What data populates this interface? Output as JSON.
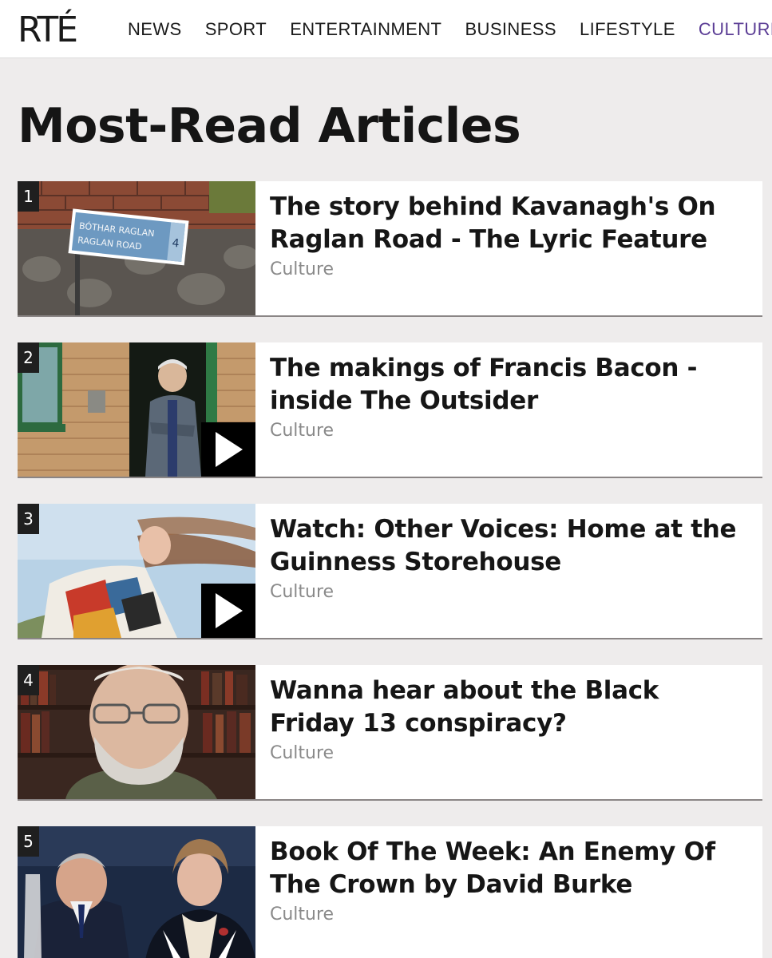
{
  "site": {
    "logo": "RTÉ"
  },
  "nav": {
    "items": [
      {
        "label": "NEWS"
      },
      {
        "label": "SPORT"
      },
      {
        "label": "ENTERTAINMENT"
      },
      {
        "label": "BUSINESS"
      },
      {
        "label": "LIFESTYLE"
      },
      {
        "label": "CULTURE"
      }
    ],
    "active": "CULTURE",
    "active_color": "#5b3d95"
  },
  "page": {
    "title": "Most-Read Articles"
  },
  "articles": [
    {
      "rank": "1",
      "title": "The story behind Kavanagh's On Raglan Road - The Lyric Feature",
      "category": "Culture",
      "has_video": false,
      "sign_line1": "BÓTHAR RAGLAN",
      "sign_line2": "RAGLAN ROAD",
      "sign_num": "4"
    },
    {
      "rank": "2",
      "title": "The makings of Francis Bacon - inside The Outsider",
      "category": "Culture",
      "has_video": true
    },
    {
      "rank": "3",
      "title": "Watch: Other Voices: Home at the Guinness Storehouse",
      "category": "Culture",
      "has_video": true
    },
    {
      "rank": "4",
      "title": "Wanna hear about the Black Friday 13 conspiracy?",
      "category": "Culture",
      "has_video": false
    },
    {
      "rank": "5",
      "title": "Book Of The Week: An Enemy Of The Crown by David Burke",
      "category": "Culture",
      "has_video": false
    }
  ]
}
